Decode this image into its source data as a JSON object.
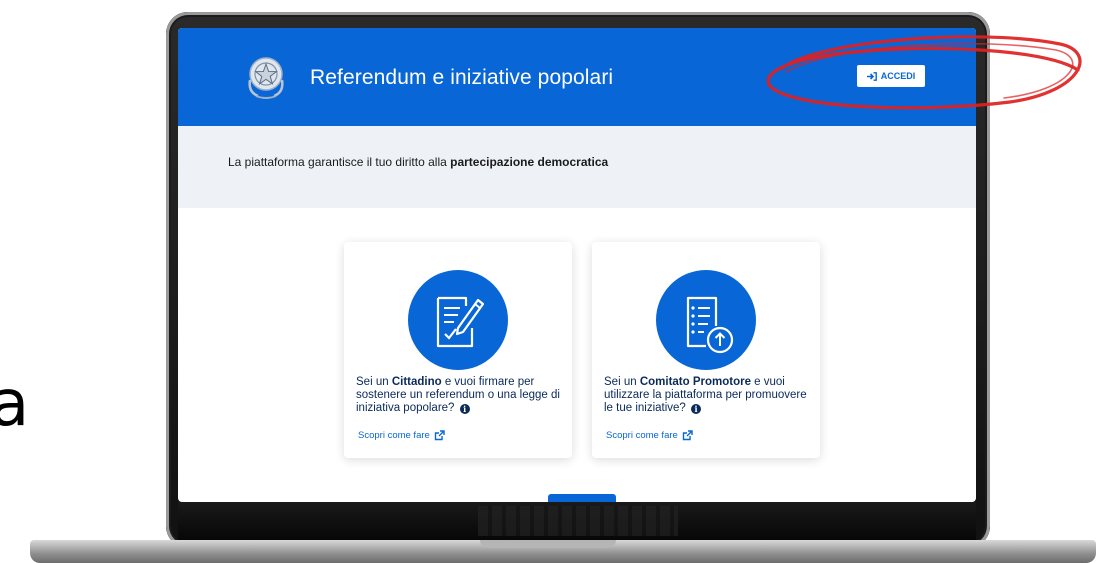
{
  "header": {
    "title": "Referendum e iniziative popolari",
    "login_label": "ACCEDI",
    "login_icon": "sign-in-icon",
    "emblem_icon": "italian-republic-emblem",
    "background_color": "#0966d6"
  },
  "banner": {
    "text_prefix": "La piattaforma garantisce il tuo diritto alla ",
    "text_bold": "partecipazione democratica"
  },
  "cards": [
    {
      "icon": "sign-document-icon",
      "text_before": "Sei un ",
      "text_bold": "Cittadino",
      "text_after": " e vuoi firmare per sostenere un referendum o una legge di iniziativa popolare?",
      "link_label": "Scopri come fare"
    },
    {
      "icon": "upload-document-icon",
      "text_before": "Sei un ",
      "text_bold": "Comitato Promotore",
      "text_after": " e vuoi utilizzare la piattaforma per promuovere le tue iniziative?",
      "link_label": "Scopri come fare"
    }
  ],
  "stray_glyph": "a",
  "annotation_color": "#e02020"
}
